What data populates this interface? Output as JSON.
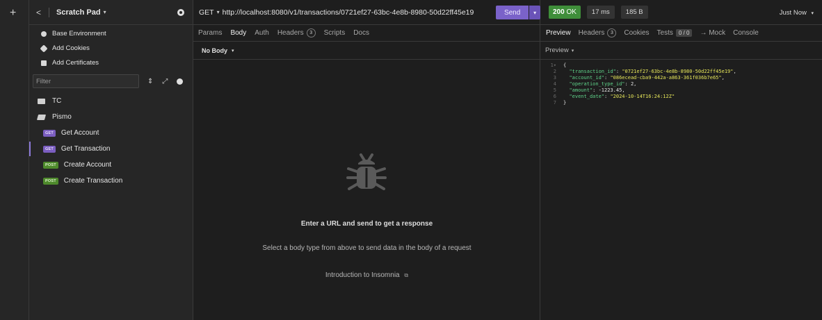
{
  "colors": {
    "accent": "#7a62c9",
    "get_badge": "#7b5ec0",
    "post_badge": "#4e8a2c",
    "status_ok": "#3f8e3a",
    "json_key": "#5fd38a",
    "json_string": "#e8e85a"
  },
  "rail": {
    "add_label": "+"
  },
  "sidebar": {
    "back_glyph": "<",
    "title": "Scratch Pad",
    "caret": "▾",
    "environment_items": [
      {
        "label": "Base Environment",
        "icon": "globe-icon"
      },
      {
        "label": "Add Cookies",
        "icon": "cookie-icon"
      },
      {
        "label": "Add Certificates",
        "icon": "certificate-icon"
      }
    ],
    "filter": {
      "placeholder": "Filter",
      "sort_glyph": "⇕",
      "expand_glyph": "⤢"
    },
    "tree": {
      "folders": [
        {
          "label": "TC",
          "open": false
        },
        {
          "label": "Pismo",
          "open": true
        }
      ],
      "requests": [
        {
          "method": "GET",
          "label": "Get Account",
          "active": false
        },
        {
          "method": "GET",
          "label": "Get Transaction",
          "active": true
        },
        {
          "method": "POST",
          "label": "Create Account",
          "active": false
        },
        {
          "method": "POST",
          "label": "Create Transaction",
          "active": false
        }
      ]
    }
  },
  "request": {
    "method": "GET",
    "method_caret": "▾",
    "url": "http://localhost:8080/v1/transactions/0721ef27-63bc-4e8b-8980-50d22ff45e19",
    "send_label": "Send",
    "send_caret": "▾",
    "tabs": [
      "Params",
      "Body",
      "Auth",
      "Headers",
      "Scripts",
      "Docs"
    ],
    "active_tab": "Body",
    "headers_count": "3",
    "body_type": "No Body",
    "body_caret": "▾",
    "empty_title": "Enter a URL and send to get a response",
    "empty_subtitle": "Select a body type from above to send data in the body of a request",
    "intro_link": "Introduction to Insomnia",
    "intro_link_glyph": "⧉"
  },
  "response": {
    "status_code": "200",
    "status_text": "OK",
    "time": "17 ms",
    "size": "185 B",
    "history_label": "Just Now",
    "history_caret": "▾",
    "tabs": [
      "Preview",
      "Headers",
      "Cookies",
      "Tests",
      "→ Mock",
      "Console"
    ],
    "active_tab": "Preview",
    "headers_count": "3",
    "tests_count": "0 / 0",
    "preview_label": "Preview",
    "preview_caret": "▾",
    "json_lines": [
      {
        "n": "1",
        "fold": "▾",
        "open": "{"
      },
      {
        "n": "2",
        "key": "\"transaction_id\"",
        "value": "\"0721ef27-63bc-4e8b-8980-50d22ff45e19\"",
        "vtype": "s",
        "comma": ","
      },
      {
        "n": "3",
        "key": "\"account_id\"",
        "value": "\"086ecead-cba9-442a-a863-361f036b7e65\"",
        "vtype": "s",
        "comma": ","
      },
      {
        "n": "4",
        "key": "\"operation_type_id\"",
        "value": "2",
        "vtype": "n",
        "comma": ","
      },
      {
        "n": "5",
        "key": "\"amount\"",
        "value": "-1223.45",
        "vtype": "n",
        "comma": ","
      },
      {
        "n": "6",
        "key": "\"event_date\"",
        "value": "\"2024-10-14T16:24:12Z\"",
        "vtype": "s",
        "comma": ""
      },
      {
        "n": "7",
        "close": "}"
      }
    ]
  }
}
